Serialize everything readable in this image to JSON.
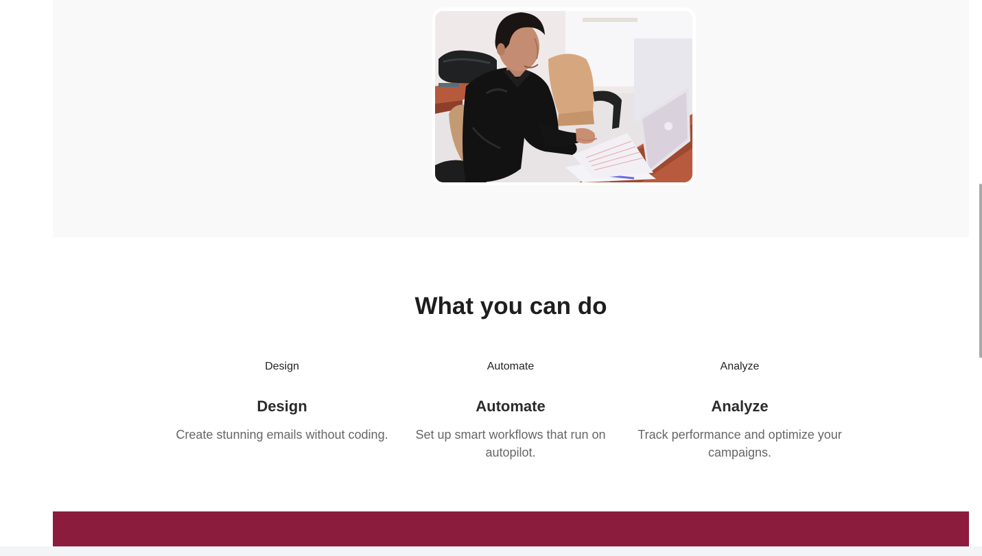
{
  "hero": {
    "image_alt": "Man working on a laptop at an office desk"
  },
  "features_section": {
    "title": "What you can do",
    "items": [
      {
        "icon_label": "Design",
        "title": "Design",
        "description": "Create stunning emails without coding."
      },
      {
        "icon_label": "Automate",
        "title": "Automate",
        "description": "Set up smart workflows that run on autopilot."
      },
      {
        "icon_label": "Analyze",
        "title": "Analyze",
        "description": "Track performance and optimize your campaigns."
      }
    ]
  },
  "colors": {
    "hero_background": "#f9f9f9",
    "footer_band": "#8b1c3d",
    "heading": "#1e1e1e",
    "body_text": "#666666"
  }
}
